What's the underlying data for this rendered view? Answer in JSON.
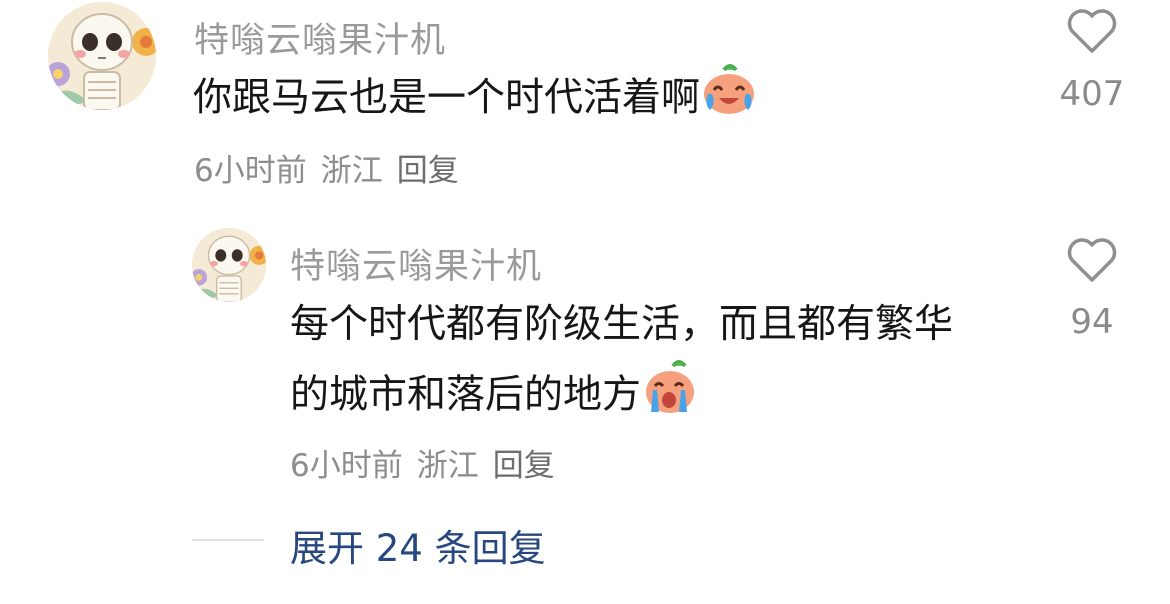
{
  "comments": [
    {
      "username": "特嗡云嗡果汁机",
      "text": "你跟马云也是一个时代活着啊",
      "emoji": "crying-laughing-peach",
      "likes": "407",
      "time": "6小时前",
      "location": "浙江",
      "reply_label": "回复"
    },
    {
      "username": "特嗡云嗡果汁机",
      "text_line1": "每个时代都有阶级生活，而且都有繁华",
      "text_line2": "的城市和落后的地方",
      "emoji": "crying-peach",
      "likes": "94",
      "time": "6小时前",
      "location": "浙江",
      "reply_label": "回复"
    }
  ],
  "expand_replies": "展开 24 条回复",
  "colors": {
    "username": "#9a9a9a",
    "text": "#161616",
    "meta": "#8d8d8d",
    "expand_link": "#27477f",
    "divider": "#e3e3e3"
  },
  "icons": [
    "heart-outline-icon",
    "skeleton-avatar",
    "peach-emoji"
  ]
}
